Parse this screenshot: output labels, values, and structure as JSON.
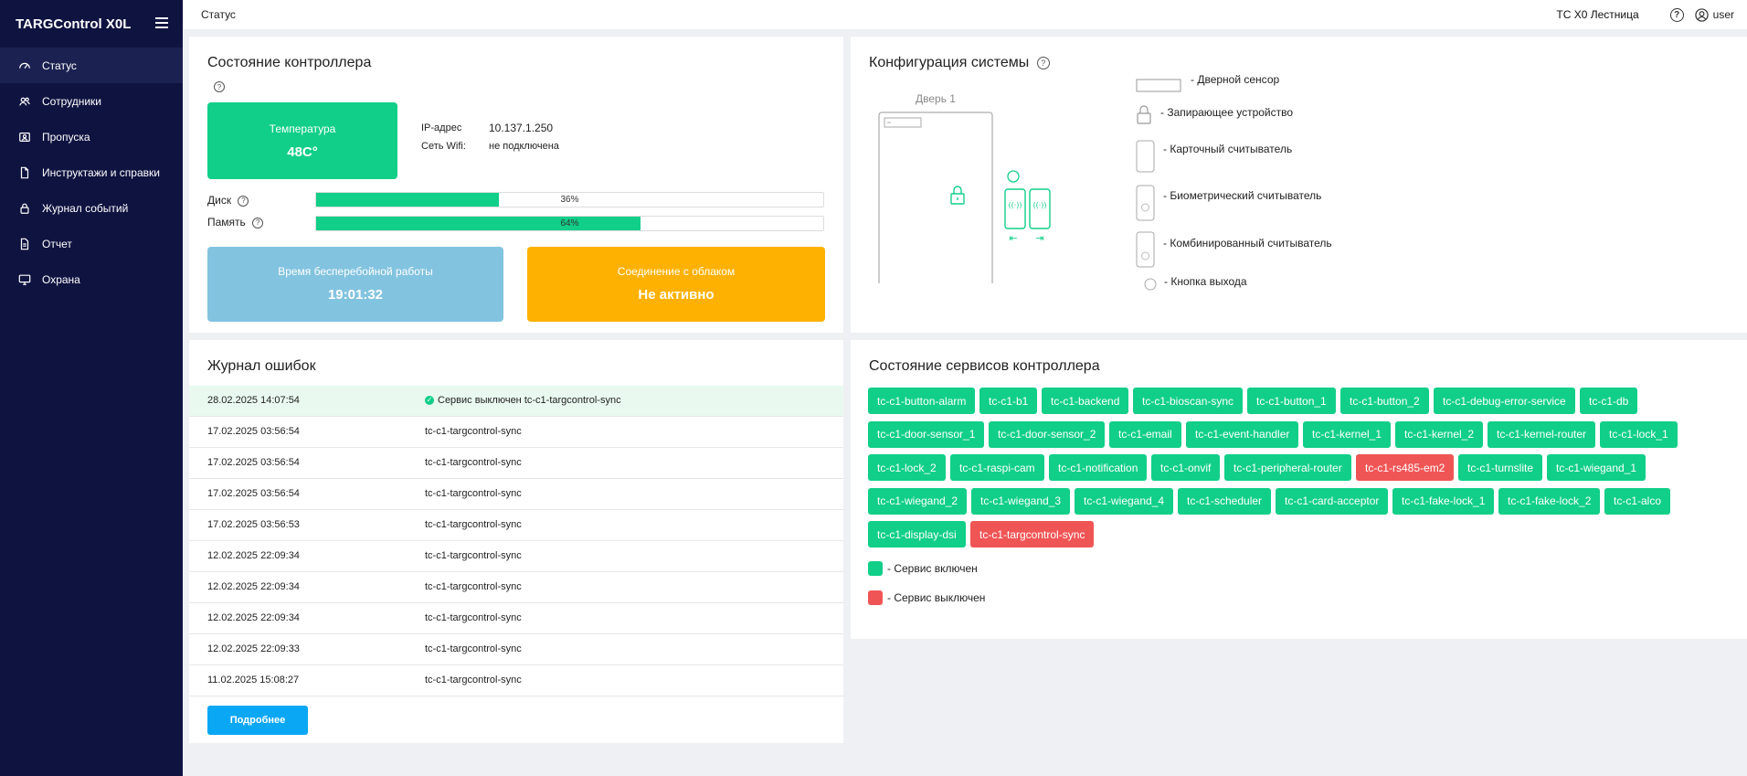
{
  "app": {
    "brand": "TARGControl X0L"
  },
  "sidebar": {
    "items": [
      {
        "label": "Статус",
        "icon": "dashboard-icon",
        "active": true
      },
      {
        "label": "Сотрудники",
        "icon": "users-icon"
      },
      {
        "label": "Пропуска",
        "icon": "id-card-icon"
      },
      {
        "label": "Инструктажи и справки",
        "icon": "document-icon"
      },
      {
        "label": "Журнал событий",
        "icon": "lock-icon"
      },
      {
        "label": "Отчет",
        "icon": "report-icon"
      },
      {
        "label": "Охрана",
        "icon": "monitor-icon"
      }
    ]
  },
  "header": {
    "page_title": "Статус",
    "object_name": "ТС X0 Лестница",
    "user": "user"
  },
  "controller_state": {
    "title": "Состояние контроллера",
    "temperature_label": "Температура",
    "temperature_value": "48C°",
    "ip_label": "IP-адрес",
    "ip_value": "10.137.1.250",
    "wifi_label": "Сеть Wifi:",
    "wifi_value": "не подключена",
    "disk_label": "Диск",
    "disk_percent": 36,
    "disk_text": "36%",
    "memory_label": "Память",
    "memory_percent": 64,
    "memory_text": "64%",
    "uptime_label": "Время бесперебойной работы",
    "uptime_value": "19:01:32",
    "cloud_label": "Соединение с облаком",
    "cloud_value": "Не активно",
    "colors": {
      "green": "#11cf88",
      "blue": "#82c3e0",
      "orange": "#ffb101"
    }
  },
  "config": {
    "title": "Конфигурация системы",
    "door_label": "Дверь 1",
    "legend": [
      "- Дверной сенсор",
      "- Запирающее устройство",
      "- Карточный считыватель",
      "- Биометрический считыватель",
      "- Комбинированный считыватель",
      "- Кнопка выхода"
    ]
  },
  "errors": {
    "title": "Журнал ошибок",
    "rows": [
      {
        "date": "28.02.2025 14:07:54",
        "message": "Сервис выключен tc-c1-targcontrol-sync",
        "ok": true
      },
      {
        "date": "17.02.2025 03:56:54",
        "message": "tc-c1-targcontrol-sync"
      },
      {
        "date": "17.02.2025 03:56:54",
        "message": "tc-c1-targcontrol-sync"
      },
      {
        "date": "17.02.2025 03:56:54",
        "message": "tc-c1-targcontrol-sync"
      },
      {
        "date": "17.02.2025 03:56:53",
        "message": "tc-c1-targcontrol-sync"
      },
      {
        "date": "12.02.2025 22:09:34",
        "message": "tc-c1-targcontrol-sync"
      },
      {
        "date": "12.02.2025 22:09:34",
        "message": "tc-c1-targcontrol-sync"
      },
      {
        "date": "12.02.2025 22:09:34",
        "message": "tc-c1-targcontrol-sync"
      },
      {
        "date": "12.02.2025 22:09:33",
        "message": "tc-c1-targcontrol-sync"
      },
      {
        "date": "11.02.2025 15:08:27",
        "message": "tc-c1-targcontrol-sync"
      }
    ],
    "more_button": "Подробнее"
  },
  "services": {
    "title": "Состояние сервисов контроллера",
    "rows": [
      [
        {
          "name": "tc-c1-button-alarm"
        },
        {
          "name": "tc-c1-b1"
        },
        {
          "name": "tc-c1-backend"
        },
        {
          "name": "tc-c1-bioscan-sync"
        },
        {
          "name": "tc-c1-button_1"
        },
        {
          "name": "tc-c1-button_2"
        },
        {
          "name": "tc-c1-debug-error-service"
        },
        {
          "name": "tc-c1-db"
        }
      ],
      [
        {
          "name": "tc-c1-door-sensor_1"
        },
        {
          "name": "tc-c1-door-sensor_2"
        },
        {
          "name": "tc-c1-email"
        },
        {
          "name": "tc-c1-event-handler"
        },
        {
          "name": "tc-c1-kernel_1"
        },
        {
          "name": "tc-c1-kernel_2"
        },
        {
          "name": "tc-c1-kernel-router"
        },
        {
          "name": "tc-c1-lock_1"
        }
      ],
      [
        {
          "name": "tc-c1-lock_2"
        },
        {
          "name": "tc-c1-raspi-cam"
        },
        {
          "name": "tc-c1-notification"
        },
        {
          "name": "tc-c1-onvif"
        },
        {
          "name": "tc-c1-peripheral-router"
        },
        {
          "name": "tc-c1-rs485-em2",
          "off": true
        },
        {
          "name": "tc-c1-turnslite"
        },
        {
          "name": "tc-c1-wiegand_1"
        }
      ],
      [
        {
          "name": "tc-c1-wiegand_2"
        },
        {
          "name": "tc-c1-wiegand_3"
        },
        {
          "name": "tc-c1-wiegand_4"
        },
        {
          "name": "tc-c1-scheduler"
        },
        {
          "name": "tc-c1-card-acceptor"
        },
        {
          "name": "tc-c1-fake-lock_1"
        },
        {
          "name": "tc-c1-fake-lock_2"
        },
        {
          "name": "tc-c1-alco"
        }
      ],
      [
        {
          "name": "tc-c1-display-dsi"
        },
        {
          "name": "tc-c1-targcontrol-sync",
          "off": true
        }
      ]
    ],
    "legend_on": "- Сервис включен",
    "legend_off": "- Сервис выключен",
    "colors": {
      "on": "#11cf88",
      "off": "#f05556"
    }
  }
}
